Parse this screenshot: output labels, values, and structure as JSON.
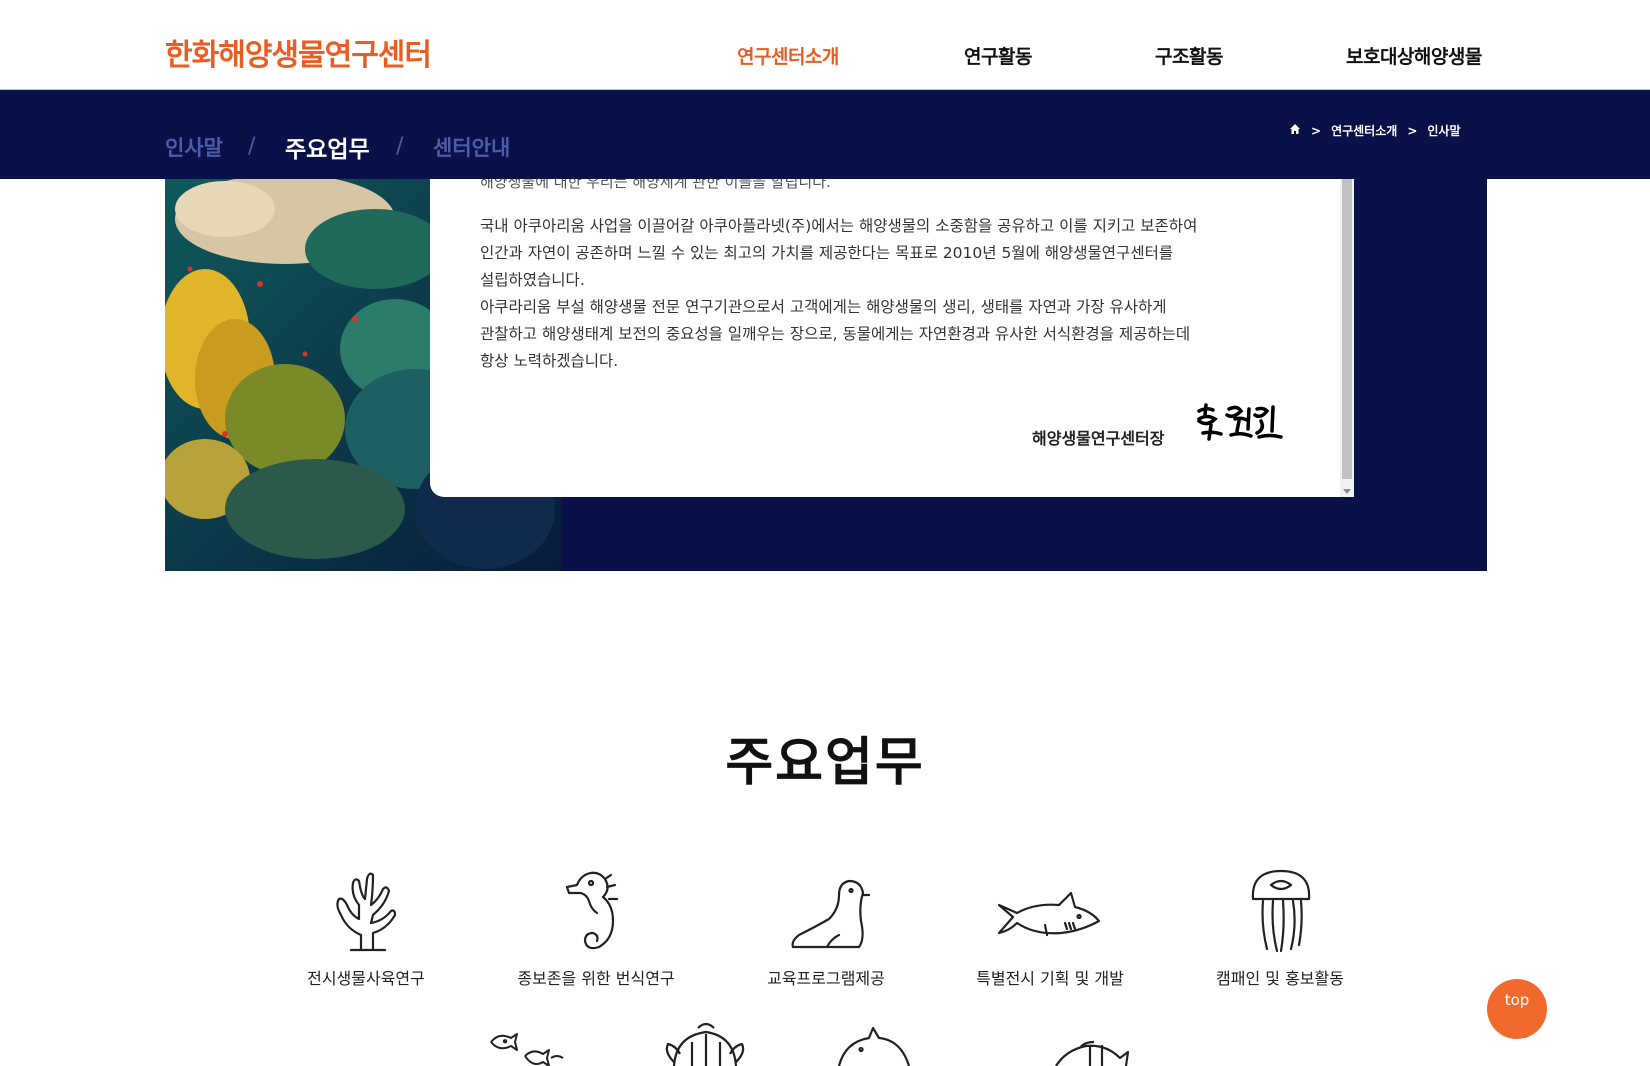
{
  "header": {
    "logo": "한화해양생물연구센터",
    "nav": [
      "연구센터소개",
      "연구활동",
      "구조활동",
      "보호대상해양생물"
    ],
    "active_nav": "연구센터소개"
  },
  "subnav": {
    "tabs": [
      "인사말",
      "주요업무",
      "센터안내"
    ],
    "separator": "/",
    "current": "주요업무",
    "breadcrumb": [
      "연구센터소개",
      "인사말"
    ],
    "breadcrumb_sep": ">"
  },
  "greeting": {
    "cut_line": "해양생물에 대한 우리는 해양세계 관한 이들을 알립니다.",
    "paragraphs": [
      "국내 아쿠아리움 사업을 이끌어갈 아쿠아플라넷(주)에서는 해양생물의 소중함을 공유하고 이를 지키고 보존하여",
      "인간과 자연이 공존하며 느낄 수 있는 최고의 가치를 제공한다는 목표로 2010년 5월에 해양생물연구센터를",
      "설립하였습니다.",
      "아쿠라리움 부설 해양생물 전문 연구기관으로서 고객에게는 해양생물의 생리, 생태를 자연과 가장 유사하게",
      "관찰하고 해양생태계 보전의 중요성을 일깨우는 장으로, 동물에게는 자연환경과 유사한 서식환경을 제공하는데",
      "항상 노력하겠습니다."
    ],
    "sign_title": "해양생물연구센터장",
    "signature": "한원민"
  },
  "duties": {
    "title": "주요업무",
    "items": [
      {
        "label": "전시생물사육연구",
        "icon": "coral-icon"
      },
      {
        "label": "종보존을 위한 번식연구",
        "icon": "seahorse-icon"
      },
      {
        "label": "교육프로그램제공",
        "icon": "seal-icon"
      },
      {
        "label": "특별전시 기획 및 개발",
        "icon": "shark-icon"
      },
      {
        "label": "캠패인 및 홍보활동",
        "icon": "jellyfish-icon"
      }
    ],
    "second_row_icons": [
      "fish-school-icon",
      "turtle-icon",
      "dolphin-icon",
      "clownfish-icon"
    ]
  },
  "top_button": {
    "label": "top"
  },
  "colors": {
    "accent": "#e85d24",
    "navy": "#0a1048",
    "tab_inactive": "#4f5aa8"
  }
}
